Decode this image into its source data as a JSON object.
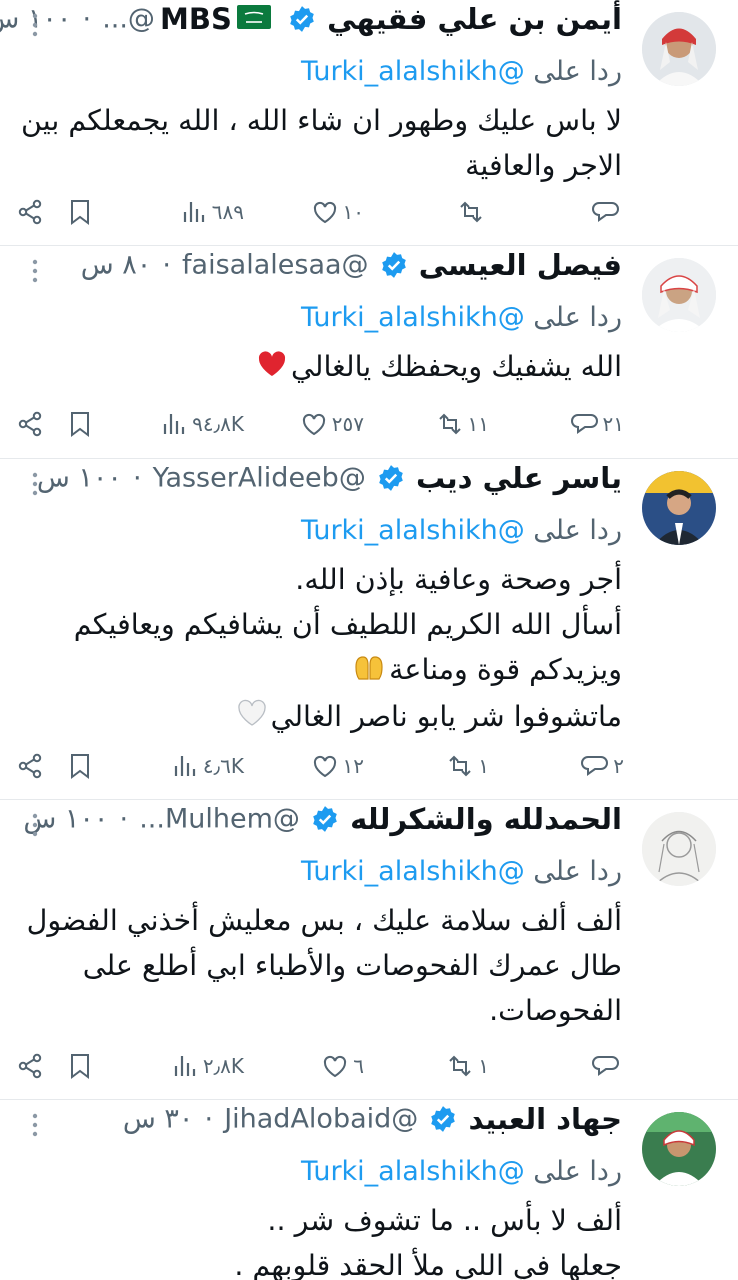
{
  "reply_prefix": "ردا على",
  "reply_to": "@Turki_alalshikh",
  "tweets": [
    {
      "name": "أيمن بن علي فقيهي",
      "name_suffix": "MBS",
      "handle": "@...",
      "time": "١٠٠ س",
      "lines": [
        "لا باس عليك وطهور ان شاء الله ، الله يجمعلكم بين",
        "الاجر والعافية"
      ],
      "stats": {
        "replies": "",
        "retweets": "",
        "likes": "١٠",
        "views": "٦٨٩"
      }
    },
    {
      "name": "فيصل العيسى",
      "handle": "@faisalalesaa",
      "time": "٨٠ س",
      "lines": [
        "الله يشفيك ويحفظك يالغالي"
      ],
      "stats": {
        "replies": "٢١",
        "retweets": "١١",
        "likes": "٢٥٧",
        "views": "٩٤٫٨K"
      }
    },
    {
      "name": "ياسر علي ديب",
      "handle": "@YasserAlideeb",
      "time": "١٠٠ س",
      "lines": [
        "أجر وصحة وعافية بإذن الله.",
        "أسأل الله الكريم اللطيف أن يشافيكم ويعافيكم",
        "ويزيدكم قوة ومناعة",
        "ماتشوفوا شر يابو ناصر الغالي"
      ],
      "stats": {
        "replies": "٢",
        "retweets": "١",
        "likes": "١٢",
        "views": "٤٫٦K"
      }
    },
    {
      "name": "الحمدلله والشكرلله",
      "handle": "@Mulhem...",
      "time": "١٠٠ س",
      "lines": [
        "ألف ألف سلامة عليك ، بس معليش أخذني الفضول",
        "طال عمرك الفحوصات والأطباء ابي أطلع على",
        "الفحوصات."
      ],
      "stats": {
        "replies": "",
        "retweets": "١",
        "likes": "٦",
        "views": "٢٫٨K"
      }
    },
    {
      "name": "جهاد العبيد",
      "handle": "@JihadAlobaid",
      "time": "٣٠ س",
      "lines": [
        "ألف لا بأس .. ما تشوف شر ..",
        "جعلها في اللي ملأ الحقد قلوبهم ."
      ],
      "stats": {
        "replies": "",
        "retweets": "",
        "likes": "",
        "views": ""
      }
    }
  ]
}
